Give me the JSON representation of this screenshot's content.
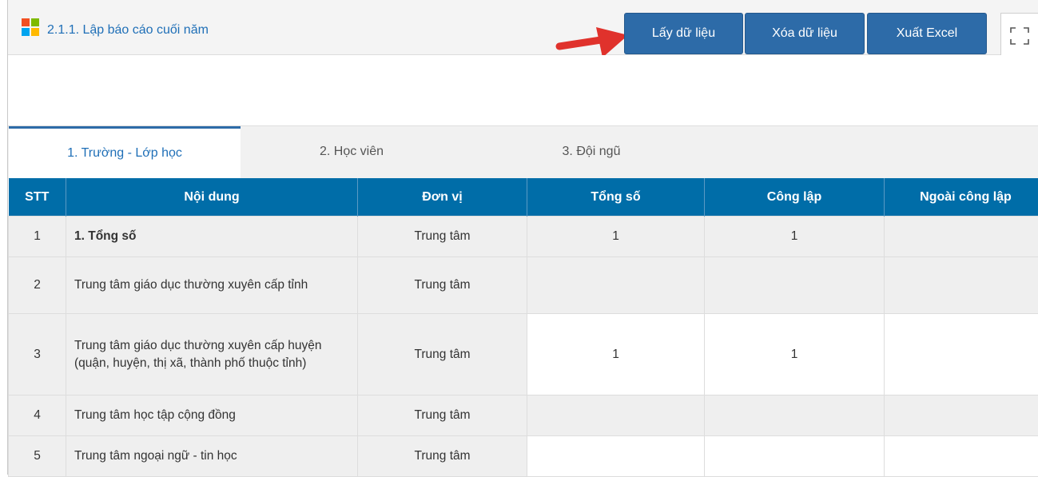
{
  "header": {
    "title": "2.1.1. Lập báo cáo cuối năm",
    "buttons": {
      "fetch": "Lấy dữ liệu",
      "clear": "Xóa dữ liệu",
      "export": "Xuất Excel"
    }
  },
  "tabs": [
    "1. Trường - Lớp học",
    "2. Học viên",
    "3. Đội ngũ"
  ],
  "table": {
    "headers": [
      "STT",
      "Nội dung",
      "Đơn vị",
      "Tổng số",
      "Công lập",
      "Ngoài công lập"
    ],
    "rows": [
      {
        "stt": "1",
        "content": "1. Tổng số",
        "unit": "Trung tâm",
        "total": "1",
        "public": "1",
        "private": ""
      },
      {
        "stt": "2",
        "content": "Trung tâm giáo dục thường xuyên cấp tỉnh",
        "unit": "Trung tâm",
        "total": "",
        "public": "",
        "private": ""
      },
      {
        "stt": "3",
        "content": "Trung tâm giáo dục thường xuyên cấp huyện (quận, huyện, thị xã, thành phố thuộc tỉnh)",
        "unit": "Trung tâm",
        "total": "1",
        "public": "1",
        "private": ""
      },
      {
        "stt": "4",
        "content": "Trung tâm học tập cộng đồng",
        "unit": "Trung tâm",
        "total": "",
        "public": "",
        "private": ""
      },
      {
        "stt": "5",
        "content": "Trung tâm ngoại ngữ - tin học",
        "unit": "Trung tâm",
        "total": "",
        "public": "",
        "private": ""
      }
    ]
  },
  "colors": {
    "accent": "#2d6ba8",
    "header_bg": "#006da8",
    "arrow": "#e0322c",
    "title": "#1f6fb7"
  }
}
